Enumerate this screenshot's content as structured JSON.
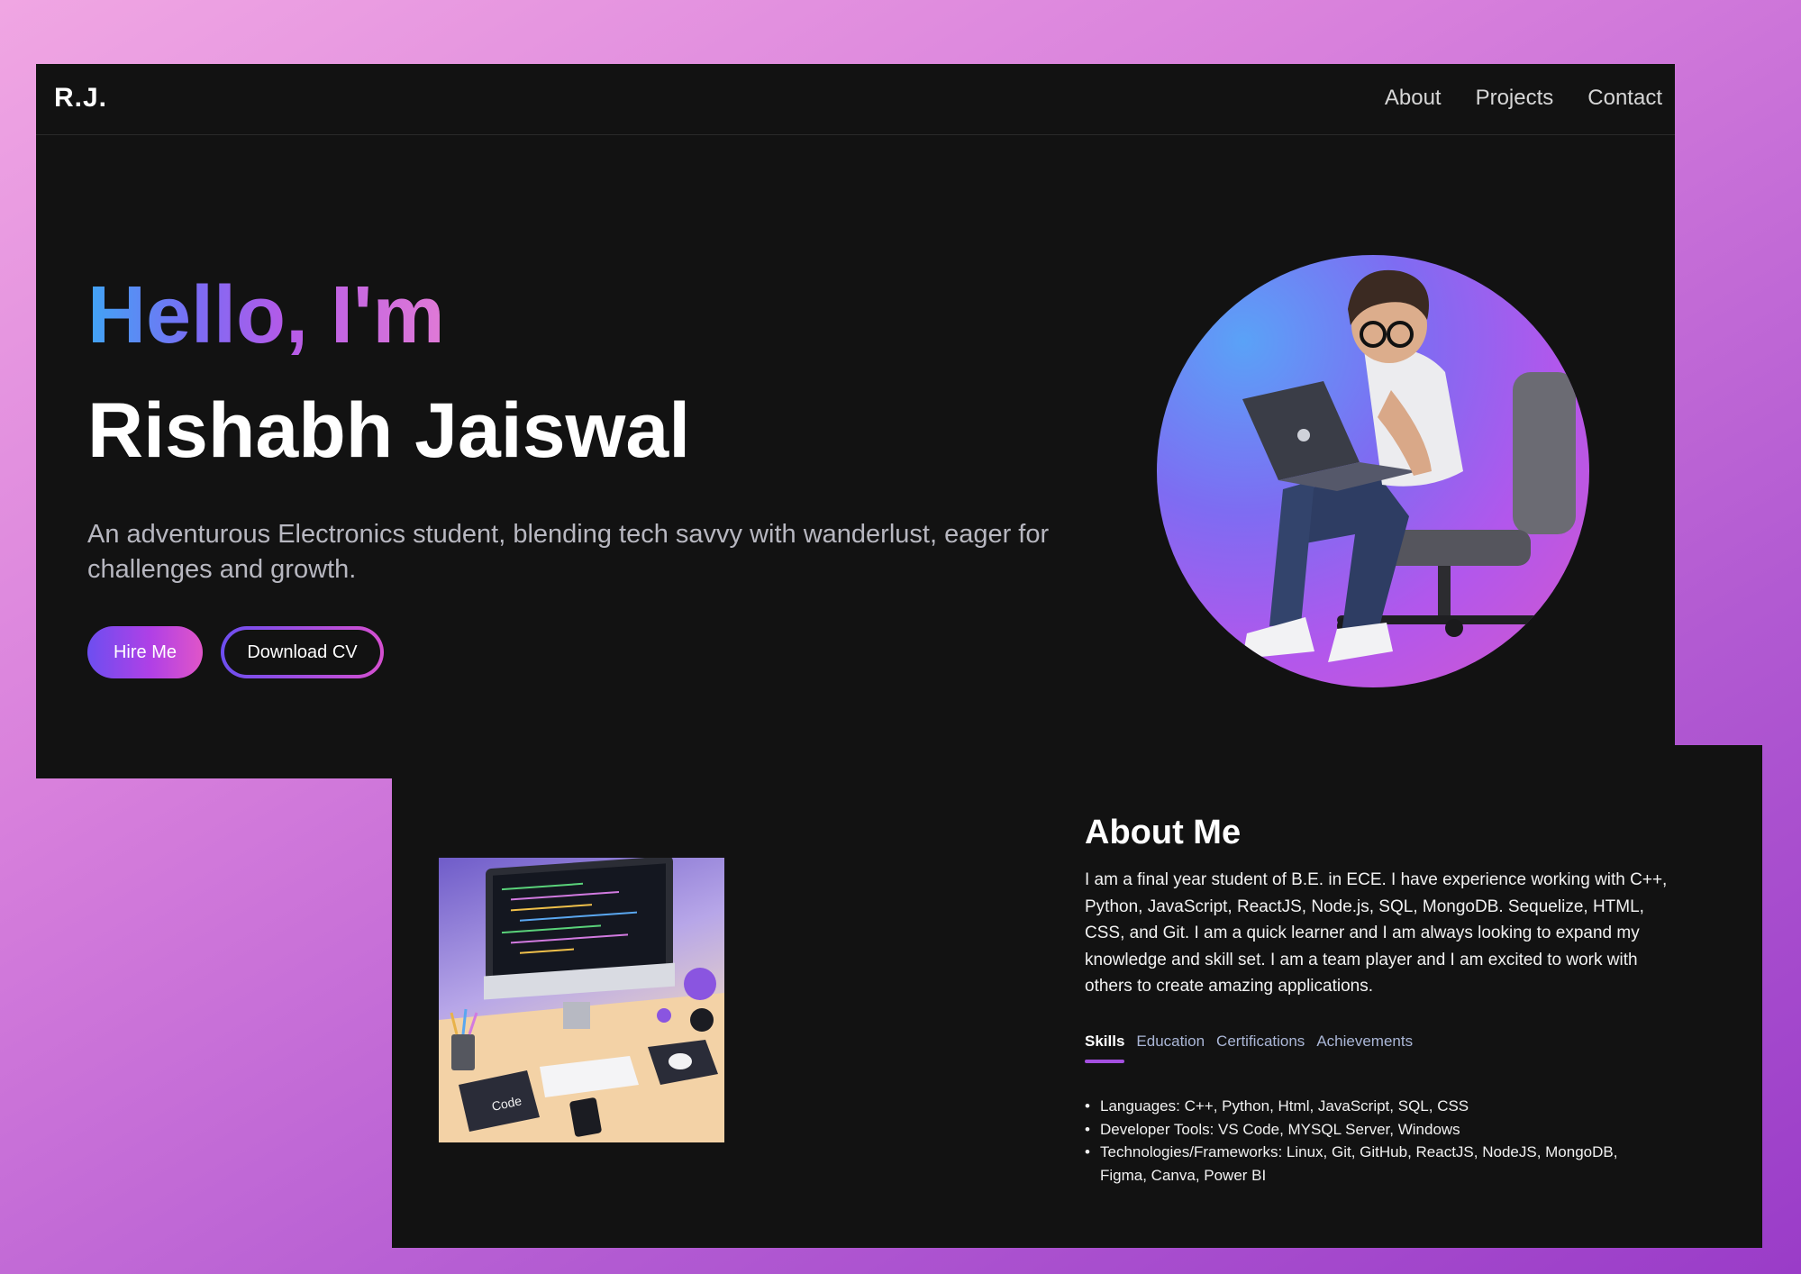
{
  "nav": {
    "logo": "R.J.",
    "links": [
      "About",
      "Projects",
      "Contact"
    ]
  },
  "hero": {
    "greeting": "Hello, I'm",
    "name": "Rishabh Jaiswal",
    "tagline": "An adventurous Electronics student, blending tech savvy with wanderlust, eager for challenges and growth.",
    "hire_button": "Hire Me",
    "cv_button": "Download CV"
  },
  "about": {
    "heading": "About Me",
    "text": "I am a final year student of B.E. in ECE. I have experience working with C++, Python, JavaScript, ReactJS, Node.js, SQL, MongoDB. Sequelize, HTML, CSS, and Git. I am a quick learner and I am always looking to expand my knowledge and skill set. I am a team player and I am excited to work with others to create amazing applications.",
    "tabs": [
      "Skills",
      "Education",
      "Certifications",
      "Achievements"
    ],
    "active_tab": "Skills",
    "skills": [
      "Languages: C++, Python, Html, JavaScript, SQL, CSS",
      "Developer Tools: VS Code, MYSQL Server, Windows",
      "Technologies/Frameworks: Linux, Git, GitHub, ReactJS, NodeJS, MongoDB, Figma, Canva, Power BI"
    ],
    "image_label": "Code"
  },
  "colors": {
    "panel": "#121212",
    "accent_purple": "#a44fe0",
    "accent_blue": "#40a5f5",
    "accent_pink": "#e07ad6"
  }
}
